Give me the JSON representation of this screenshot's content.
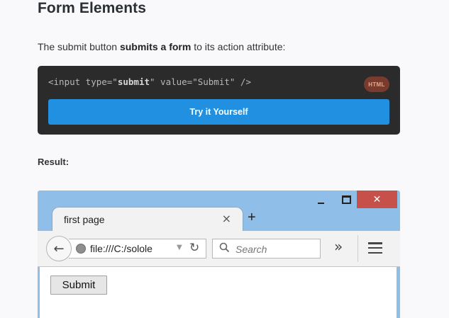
{
  "heading": "Form Elements",
  "intro": {
    "before": "The submit button ",
    "bold": "submits a form",
    "after": " to its action attribute:"
  },
  "code": {
    "prefix": "<input type=\"",
    "keyword": "submit",
    "suffix": "\" value=\"Submit\" />",
    "language_badge": "HTML",
    "try_button_label": "Try it Yourself"
  },
  "result_label": "Result:",
  "browser": {
    "tab_title": "first page",
    "tab_close": "×",
    "new_tab": "+",
    "url": "file:///C:/solole",
    "search_placeholder": "Search",
    "overflow": "»",
    "window_close": "✕",
    "page": {
      "submit_label": "Submit"
    }
  }
}
